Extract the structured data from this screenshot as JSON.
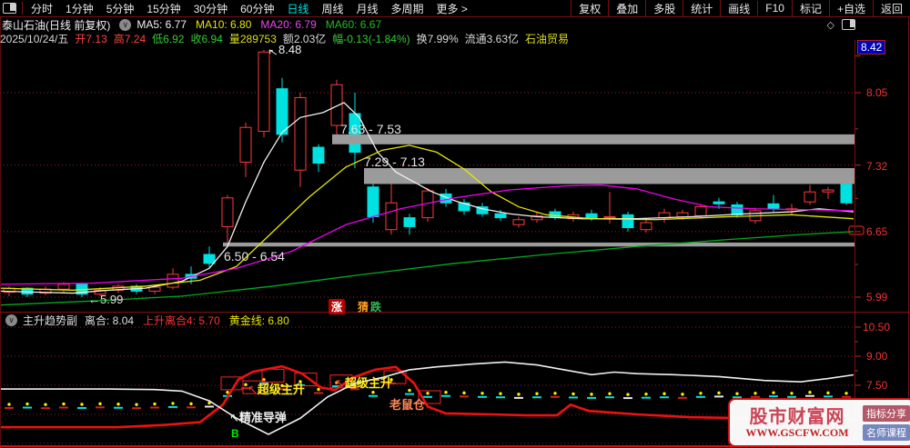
{
  "toolbar": {
    "tabs": [
      {
        "label": "分时"
      },
      {
        "label": "1分钟"
      },
      {
        "label": "5分钟"
      },
      {
        "label": "15分钟"
      },
      {
        "label": "30分钟"
      },
      {
        "label": "60分钟"
      },
      {
        "label": "日线"
      },
      {
        "label": "周线"
      },
      {
        "label": "月线"
      },
      {
        "label": "多周期"
      },
      {
        "label": "更多 >"
      }
    ],
    "active_tab": "日线",
    "right_buttons": [
      {
        "label": "复权"
      },
      {
        "label": "叠加"
      },
      {
        "label": "多股"
      },
      {
        "label": "统计"
      },
      {
        "label": "画线"
      },
      {
        "label": "F10"
      },
      {
        "label": "标记"
      },
      {
        "label": "+自选"
      },
      {
        "label": "返回"
      }
    ]
  },
  "title_bar": {
    "stock": "泰山石油(日线 前复权)",
    "mas": [
      {
        "label": "MA5: 6.77",
        "color": "#f0f0f0"
      },
      {
        "label": "MA10: 6.80",
        "color": "#e6e600"
      },
      {
        "label": "MA20: 6.79",
        "color": "#ee44ee"
      },
      {
        "label": "MA60: 6.67",
        "color": "#22bb22"
      }
    ]
  },
  "info_bar": {
    "date": "2025/10/24/五",
    "open": "开7.13",
    "high": "高7.24",
    "low": "低6.92",
    "close": "收6.94",
    "volume": "量289753",
    "amount": "额2.03亿",
    "change": "幅-0.13(-1.84%)",
    "turnover": "换7.99%",
    "float_shares": "流通3.63亿",
    "sector": "石油贸易"
  },
  "guess_widget": {
    "up": "涨",
    "guess": "猜",
    "down": "跌"
  },
  "sub_header": {
    "name": "主升趋势副",
    "value1": "离合: 8.04",
    "value2": "上升离合4: 5.70",
    "value3": "黄金线: 6.80"
  },
  "watermark": {
    "title": "股市财富网",
    "url": "WWW.GSCFW.COM",
    "badge1": "指标分享",
    "badge2": "名师课程"
  },
  "chart_data": {
    "type": "candlestick",
    "title": "泰山石油 日线 前复权",
    "main": {
      "ylim": [
        5.99,
        8.48
      ],
      "axis_labels": [
        {
          "t": "8.42",
          "v": 8.42,
          "highlight": true
        },
        {
          "t": "8.05",
          "v": 8.05
        },
        {
          "t": "7.32",
          "v": 7.32
        },
        {
          "t": "6.65",
          "v": 6.65
        },
        {
          "t": "5.99",
          "v": 5.99
        }
      ],
      "gridlines": [
        8.05,
        7.32,
        6.65,
        5.99
      ],
      "minor_ticks": [
        7.685,
        6.985,
        6.32
      ],
      "peak_label": "8.48",
      "low_label": "←5.99",
      "candles": [
        [
          6.04,
          6.08,
          6.0,
          6.1
        ],
        [
          6.08,
          6.02,
          5.99,
          6.09
        ],
        [
          6.03,
          6.07,
          6.01,
          6.1
        ],
        [
          6.07,
          6.12,
          6.04,
          6.14
        ],
        [
          6.12,
          6.02,
          5.99,
          6.13
        ],
        [
          6.02,
          6.06,
          6.0,
          6.09
        ],
        [
          6.06,
          6.1,
          6.03,
          6.12
        ],
        [
          6.1,
          6.05,
          6.02,
          6.12
        ],
        [
          6.05,
          6.09,
          6.02,
          6.11
        ],
        [
          6.09,
          6.22,
          6.07,
          6.28
        ],
        [
          6.22,
          6.18,
          6.12,
          6.3
        ],
        [
          6.42,
          6.33,
          6.28,
          6.5
        ],
        [
          6.7,
          6.99,
          6.54,
          7.02
        ],
        [
          7.35,
          7.7,
          7.2,
          7.75
        ],
        [
          7.66,
          8.46,
          7.6,
          8.48
        ],
        [
          8.09,
          7.63,
          7.55,
          8.2
        ],
        [
          7.27,
          8.0,
          7.1,
          8.05
        ],
        [
          7.5,
          7.34,
          7.25,
          7.53
        ],
        [
          7.72,
          8.13,
          7.63,
          8.18
        ],
        [
          7.84,
          7.45,
          7.29,
          8.05
        ],
        [
          7.1,
          6.8,
          6.74,
          7.13
        ],
        [
          6.67,
          6.94,
          6.62,
          7.19
        ],
        [
          6.79,
          6.7,
          6.62,
          6.83
        ],
        [
          6.79,
          7.06,
          6.75,
          7.09
        ],
        [
          7.03,
          6.94,
          6.9,
          7.08
        ],
        [
          6.94,
          6.86,
          6.82,
          6.98
        ],
        [
          6.9,
          6.83,
          6.8,
          6.94
        ],
        [
          6.83,
          6.79,
          6.76,
          6.87
        ],
        [
          6.72,
          6.77,
          6.69,
          6.8
        ],
        [
          6.77,
          6.81,
          6.74,
          6.84
        ],
        [
          6.85,
          6.8,
          6.77,
          6.88
        ],
        [
          6.78,
          6.82,
          6.75,
          6.85
        ],
        [
          6.83,
          6.79,
          6.76,
          6.87
        ],
        [
          6.8,
          6.8,
          6.73,
          7.05
        ],
        [
          6.82,
          6.69,
          6.65,
          6.85
        ],
        [
          6.67,
          6.74,
          6.64,
          6.77
        ],
        [
          6.79,
          6.84,
          6.74,
          6.88
        ],
        [
          6.8,
          6.84,
          6.77,
          6.87
        ],
        [
          6.81,
          6.9,
          6.78,
          6.93
        ],
        [
          6.95,
          6.93,
          6.88,
          6.99
        ],
        [
          6.92,
          6.82,
          6.79,
          6.95
        ],
        [
          6.76,
          6.86,
          6.73,
          6.89
        ],
        [
          6.93,
          6.88,
          6.85,
          7.02
        ],
        [
          6.88,
          6.88,
          6.82,
          6.93
        ],
        [
          6.95,
          7.05,
          6.92,
          7.12
        ],
        [
          7.05,
          7.07,
          6.98,
          7.1
        ],
        [
          7.13,
          6.94,
          6.92,
          7.24
        ]
      ],
      "up_color": "#ff3a3a",
      "down_color": "#00e2e2",
      "bands": [
        {
          "label": "7.63 - 7.53",
          "x": 365,
          "lo": 7.53,
          "hi": 7.63
        },
        {
          "label": "7.29 - 7.13",
          "x": 400,
          "lo": 7.13,
          "hi": 7.29
        },
        {
          "label": "6.50 - 6.54",
          "x": 245,
          "lo": 6.5,
          "hi": 6.54
        }
      ],
      "mas": [
        {
          "name": "MA5",
          "color": "#f0f0f0",
          "points": [
            [
              0,
              6.05
            ],
            [
              40,
              6.04
            ],
            [
              80,
              6.03
            ],
            [
              120,
              6.06
            ],
            [
              160,
              6.08
            ],
            [
              200,
              6.15
            ],
            [
              230,
              6.28
            ],
            [
              250,
              6.5
            ],
            [
              270,
              6.95
            ],
            [
              290,
              7.35
            ],
            [
              310,
              7.65
            ],
            [
              330,
              7.8
            ],
            [
              355,
              7.85
            ],
            [
              378,
              7.95
            ],
            [
              395,
              7.8
            ],
            [
              415,
              7.45
            ],
            [
              435,
              7.25
            ],
            [
              455,
              7.15
            ],
            [
              475,
              7.05
            ],
            [
              500,
              6.96
            ],
            [
              530,
              6.88
            ],
            [
              560,
              6.83
            ],
            [
              590,
              6.8
            ],
            [
              640,
              6.78
            ],
            [
              700,
              6.78
            ],
            [
              760,
              6.8
            ],
            [
              820,
              6.83
            ],
            [
              870,
              6.85
            ],
            [
              900,
              6.88
            ],
            [
              938,
              6.85
            ]
          ]
        },
        {
          "name": "MA10",
          "color": "#e6e600",
          "points": [
            [
              0,
              6.08
            ],
            [
              80,
              6.06
            ],
            [
              160,
              6.1
            ],
            [
              220,
              6.16
            ],
            [
              260,
              6.3
            ],
            [
              300,
              6.65
            ],
            [
              340,
              7.0
            ],
            [
              380,
              7.3
            ],
            [
              420,
              7.47
            ],
            [
              450,
              7.52
            ],
            [
              480,
              7.45
            ],
            [
              510,
              7.28
            ],
            [
              540,
              7.05
            ],
            [
              570,
              6.9
            ],
            [
              600,
              6.82
            ],
            [
              650,
              6.78
            ],
            [
              720,
              6.77
            ],
            [
              800,
              6.8
            ],
            [
              870,
              6.82
            ],
            [
              938,
              6.78
            ]
          ]
        },
        {
          "name": "MA20",
          "color": "#ee00ee",
          "points": [
            [
              0,
              6.12
            ],
            [
              100,
              6.13
            ],
            [
              200,
              6.18
            ],
            [
              260,
              6.28
            ],
            [
              320,
              6.45
            ],
            [
              380,
              6.72
            ],
            [
              440,
              6.88
            ],
            [
              500,
              6.99
            ],
            [
              560,
              7.07
            ],
            [
              620,
              7.11
            ],
            [
              660,
              7.12
            ],
            [
              700,
              7.08
            ],
            [
              740,
              6.98
            ],
            [
              780,
              6.9
            ],
            [
              830,
              6.88
            ],
            [
              890,
              6.87
            ],
            [
              938,
              6.86
            ]
          ]
        },
        {
          "name": "MA60",
          "color": "#00aa22",
          "points": [
            [
              0,
              5.91
            ],
            [
              100,
              5.95
            ],
            [
              200,
              6.0
            ],
            [
              300,
              6.1
            ],
            [
              400,
              6.22
            ],
            [
              500,
              6.33
            ],
            [
              600,
              6.42
            ],
            [
              700,
              6.5
            ],
            [
              800,
              6.57
            ],
            [
              880,
              6.62
            ],
            [
              938,
              6.65
            ]
          ]
        }
      ]
    },
    "sub": {
      "name": "主升趋势副",
      "axis_labels": [
        {
          "t": "10.50",
          "v": 10.5
        },
        {
          "t": "9.00",
          "v": 9.0
        },
        {
          "t": "7.50",
          "v": 7.5
        }
      ],
      "gridlines": [
        10.5,
        9.0,
        7.5,
        6.0,
        4.5
      ],
      "minor_ticks": [
        9.75,
        8.25,
        6.75
      ],
      "lines": [
        {
          "name": "lihe",
          "color": "#ee1111",
          "width": 2.6,
          "points": [
            [
              0,
              5.34
            ],
            [
              130,
              5.34
            ],
            [
              180,
              5.45
            ],
            [
              220,
              5.6
            ],
            [
              245,
              6.5
            ],
            [
              262,
              7.8
            ],
            [
              278,
              8.2
            ],
            [
              310,
              8.48
            ],
            [
              332,
              8.1
            ],
            [
              352,
              7.4
            ],
            [
              368,
              7.25
            ],
            [
              388,
              7.9
            ],
            [
              412,
              8.3
            ],
            [
              435,
              8.45
            ],
            [
              455,
              7.6
            ],
            [
              470,
              6.4
            ],
            [
              490,
              6.05
            ],
            [
              540,
              6.0
            ],
            [
              580,
              5.95
            ],
            [
              612,
              5.95
            ],
            [
              627,
              6.5
            ],
            [
              647,
              6.18
            ],
            [
              700,
              6.0
            ],
            [
              760,
              5.85
            ],
            [
              850,
              5.78
            ],
            [
              938,
              5.7
            ]
          ]
        },
        {
          "name": "huangjin",
          "color": "#f0f0f0",
          "width": 1.6,
          "points": [
            [
              0,
              7.31
            ],
            [
              120,
              7.31
            ],
            [
              170,
              7.28
            ],
            [
              200,
              7.2
            ],
            [
              230,
              6.7
            ],
            [
              260,
              5.8
            ],
            [
              295,
              4.97
            ],
            [
              330,
              5.8
            ],
            [
              360,
              6.9
            ],
            [
              390,
              7.6
            ],
            [
              420,
              7.9
            ],
            [
              450,
              8.3
            ],
            [
              480,
              8.45
            ],
            [
              520,
              8.6
            ],
            [
              555,
              8.7
            ],
            [
              590,
              8.55
            ],
            [
              620,
              8.3
            ],
            [
              650,
              8.05
            ],
            [
              675,
              8.18
            ],
            [
              700,
              8.1
            ],
            [
              740,
              8.05
            ],
            [
              790,
              7.95
            ],
            [
              840,
              7.75
            ],
            [
              880,
              7.68
            ],
            [
              910,
              7.85
            ],
            [
              938,
              8.04
            ]
          ]
        }
      ],
      "markers": {
        "values": [
          6.33,
          6.35,
          6.32,
          6.35,
          6.33,
          6.36,
          6.34,
          6.32,
          6.35,
          6.38,
          6.36,
          6.4,
          6.95,
          7.35,
          7.6,
          7.3,
          7.5,
          7.1,
          7.45,
          7.3,
          6.95,
          7.6,
          7.05,
          6.9,
          6.95,
          6.92,
          6.9,
          6.88,
          6.85,
          6.88,
          6.9,
          6.87,
          6.85,
          6.88,
          6.84,
          6.86,
          6.88,
          6.85,
          6.9,
          6.92,
          6.88,
          6.9,
          6.93,
          6.9,
          6.95,
          6.92,
          6.9
        ],
        "colors_a": "rcrrcrcrrcrwcrcrcrcrcrc",
        "colors_b": "ccrccwcrcccwccrcwcrccwcr",
        "dot_color": "#ffee00"
      },
      "boxes": [
        [
          255,
          7.6
        ],
        [
          279,
          7.4
        ],
        [
          300,
          8.0
        ],
        [
          336,
          7.8
        ],
        [
          375,
          7.7
        ],
        [
          434,
          7.92
        ],
        [
          472,
          6.89
        ]
      ],
      "annotations": [
        {
          "text": "超级主升",
          "arrow": "↖",
          "arrow_color": "red",
          "color": "yellow"
        },
        {
          "text": "超级主升",
          "arrow": "↖",
          "arrow_color": "red",
          "color": "yellow"
        },
        {
          "text": "精准导弹",
          "arrow": "↖",
          "arrow_color": "white",
          "color": "white"
        },
        {
          "text": "老鼠仓",
          "arrow": "",
          "color": "orange"
        },
        {
          "text": "B",
          "arrow": "",
          "color": "green"
        }
      ]
    }
  }
}
